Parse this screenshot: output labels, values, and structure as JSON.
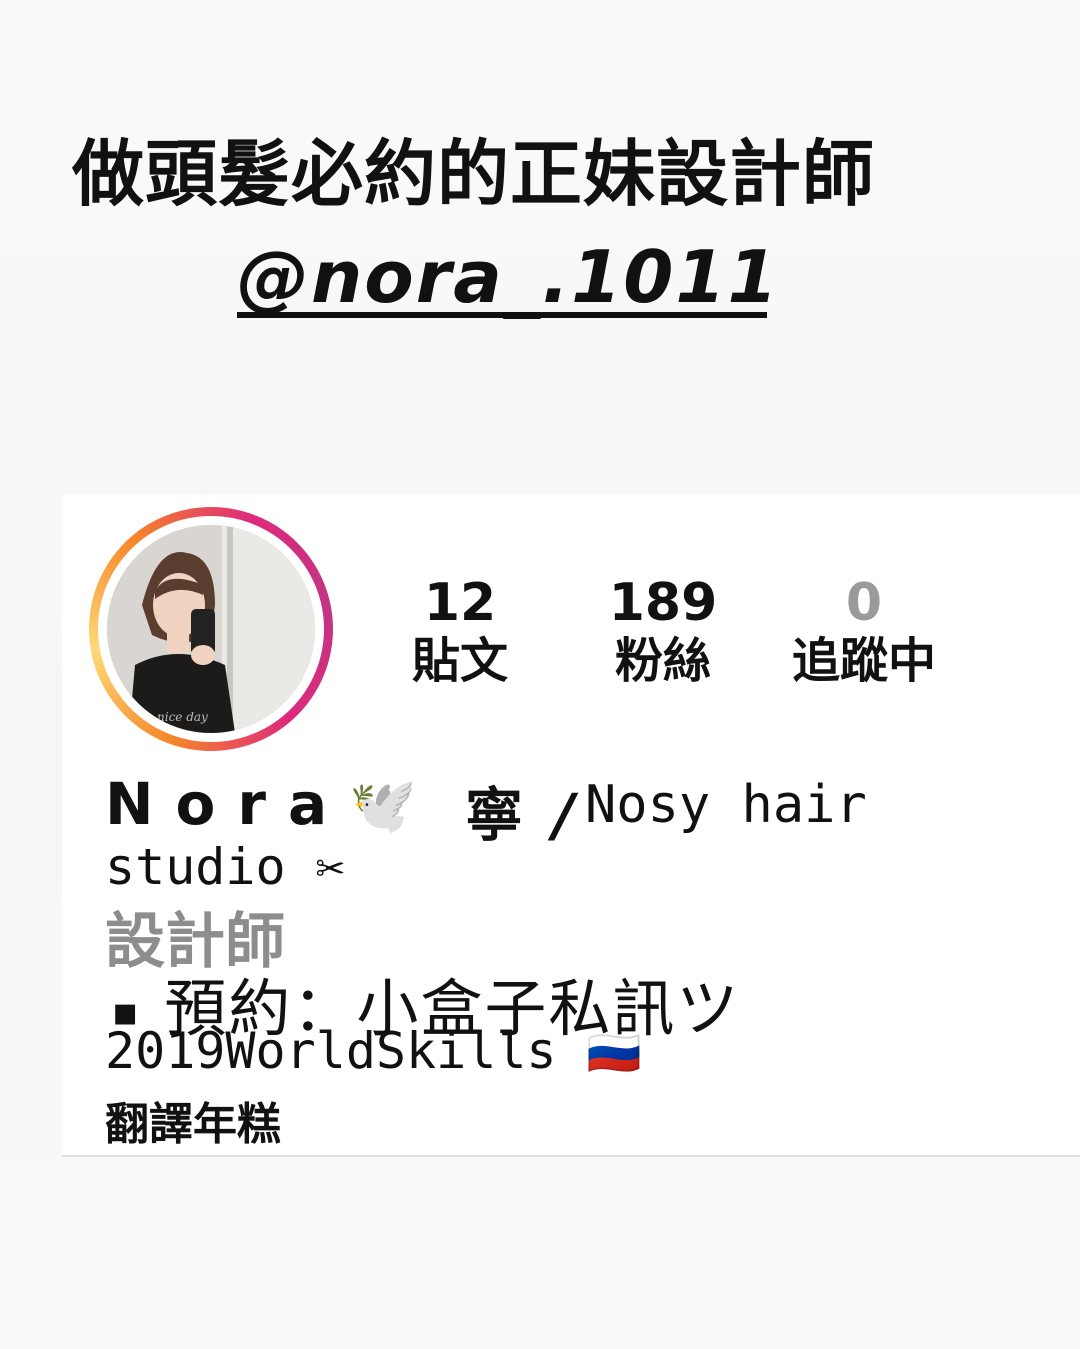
{
  "story": {
    "headline": "做頭髮必約的正妹設計師",
    "mention": "@nora_.1011"
  },
  "profile": {
    "stats": [
      {
        "value": "12",
        "label": "貼文"
      },
      {
        "value": "189",
        "label": "粉絲"
      },
      {
        "value": "0",
        "label": "追蹤中"
      }
    ],
    "bio": {
      "name": "Nora",
      "dove_emoji": "🕊️",
      "name_cn": "寧",
      "slash": "/",
      "studio_part1": "Nosy hair",
      "studio_part2": "studio",
      "scissors": "✂",
      "role": "設計師",
      "square": "◾",
      "booking": "預約：小盒子私訊ツ",
      "worldskills": "2019WorldSkills",
      "flag": "🇷🇺",
      "translation_link": "翻譯年糕"
    }
  },
  "colors": {
    "ring_start": "#f58529",
    "ring_end": "#dd2a7b",
    "role_gray": "#8d8d8d"
  }
}
